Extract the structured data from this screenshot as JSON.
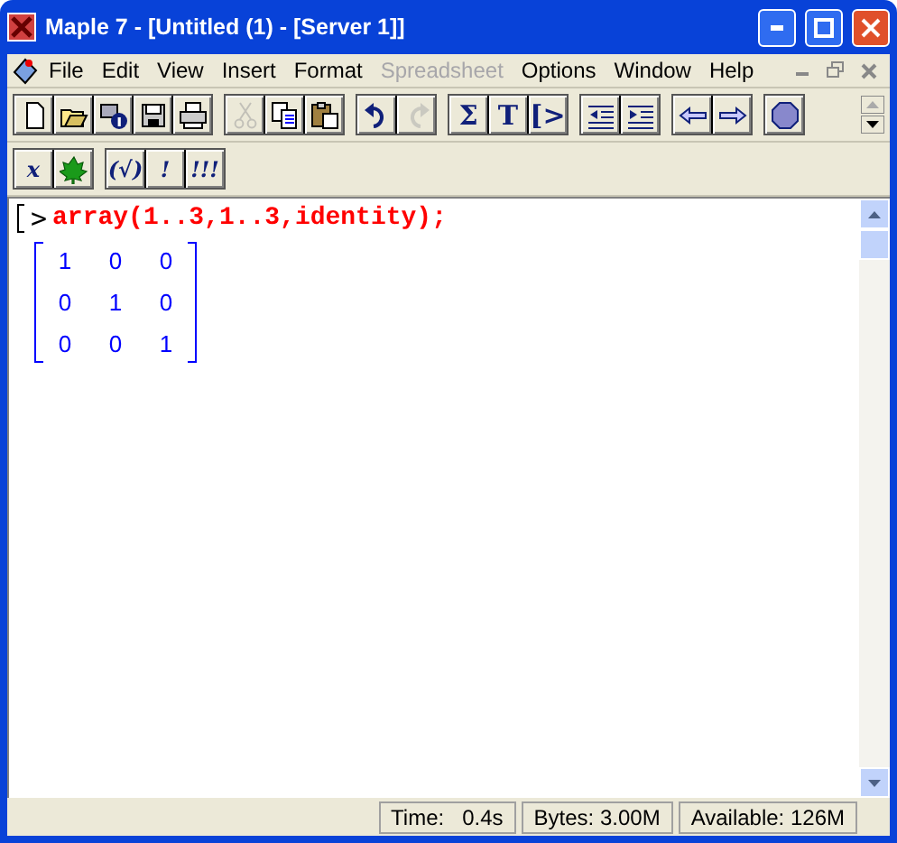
{
  "window": {
    "title": "Maple 7  - [Untitled (1) - [Server 1]]"
  },
  "menu": [
    {
      "label": "File",
      "disabled": false
    },
    {
      "label": "Edit",
      "disabled": false
    },
    {
      "label": "View",
      "disabled": false
    },
    {
      "label": "Insert",
      "disabled": false
    },
    {
      "label": "Format",
      "disabled": false
    },
    {
      "label": "Spreadsheet",
      "disabled": true
    },
    {
      "label": "Options",
      "disabled": false
    },
    {
      "label": "Window",
      "disabled": false
    },
    {
      "label": "Help",
      "disabled": false
    }
  ],
  "toolbar": [
    [
      {
        "kind": "new",
        "disabled": false
      },
      {
        "kind": "open",
        "disabled": false
      },
      {
        "kind": "info",
        "disabled": false
      },
      {
        "kind": "save",
        "disabled": false
      },
      {
        "kind": "print",
        "disabled": false
      }
    ],
    [
      {
        "kind": "cut",
        "disabled": true
      },
      {
        "kind": "copy",
        "disabled": false
      },
      {
        "kind": "paste",
        "disabled": false
      }
    ],
    [
      {
        "kind": "undo",
        "disabled": false
      },
      {
        "kind": "redo",
        "disabled": true
      }
    ],
    [
      {
        "kind": "text",
        "label": "Σ",
        "disabled": false
      },
      {
        "kind": "text",
        "label": "T",
        "disabled": false
      },
      {
        "kind": "text",
        "label": "[>",
        "disabled": false
      }
    ],
    [
      {
        "kind": "outdent",
        "disabled": false
      },
      {
        "kind": "indent",
        "disabled": false
      }
    ],
    [
      {
        "kind": "back",
        "disabled": false
      },
      {
        "kind": "forward",
        "disabled": false
      }
    ],
    [
      {
        "kind": "stop",
        "disabled": false
      }
    ]
  ],
  "context_bar": [
    [
      {
        "kind": "text",
        "label": "x",
        "disabled": false
      },
      {
        "kind": "leaf",
        "disabled": false
      }
    ],
    [
      {
        "kind": "text",
        "label": "(√)",
        "disabled": false
      },
      {
        "kind": "text",
        "label": "!",
        "disabled": false
      },
      {
        "kind": "text",
        "label": "!!!",
        "disabled": false
      }
    ]
  ],
  "worksheet": {
    "prompt": ">",
    "input": "array(1..3,1..3,identity);",
    "matrix": [
      [
        "1",
        "0",
        "0"
      ],
      [
        "0",
        "1",
        "0"
      ],
      [
        "0",
        "0",
        "1"
      ]
    ]
  },
  "status_bar": [
    "Time:   0.4s",
    "Bytes: 3.00M",
    "Available: 126M"
  ]
}
